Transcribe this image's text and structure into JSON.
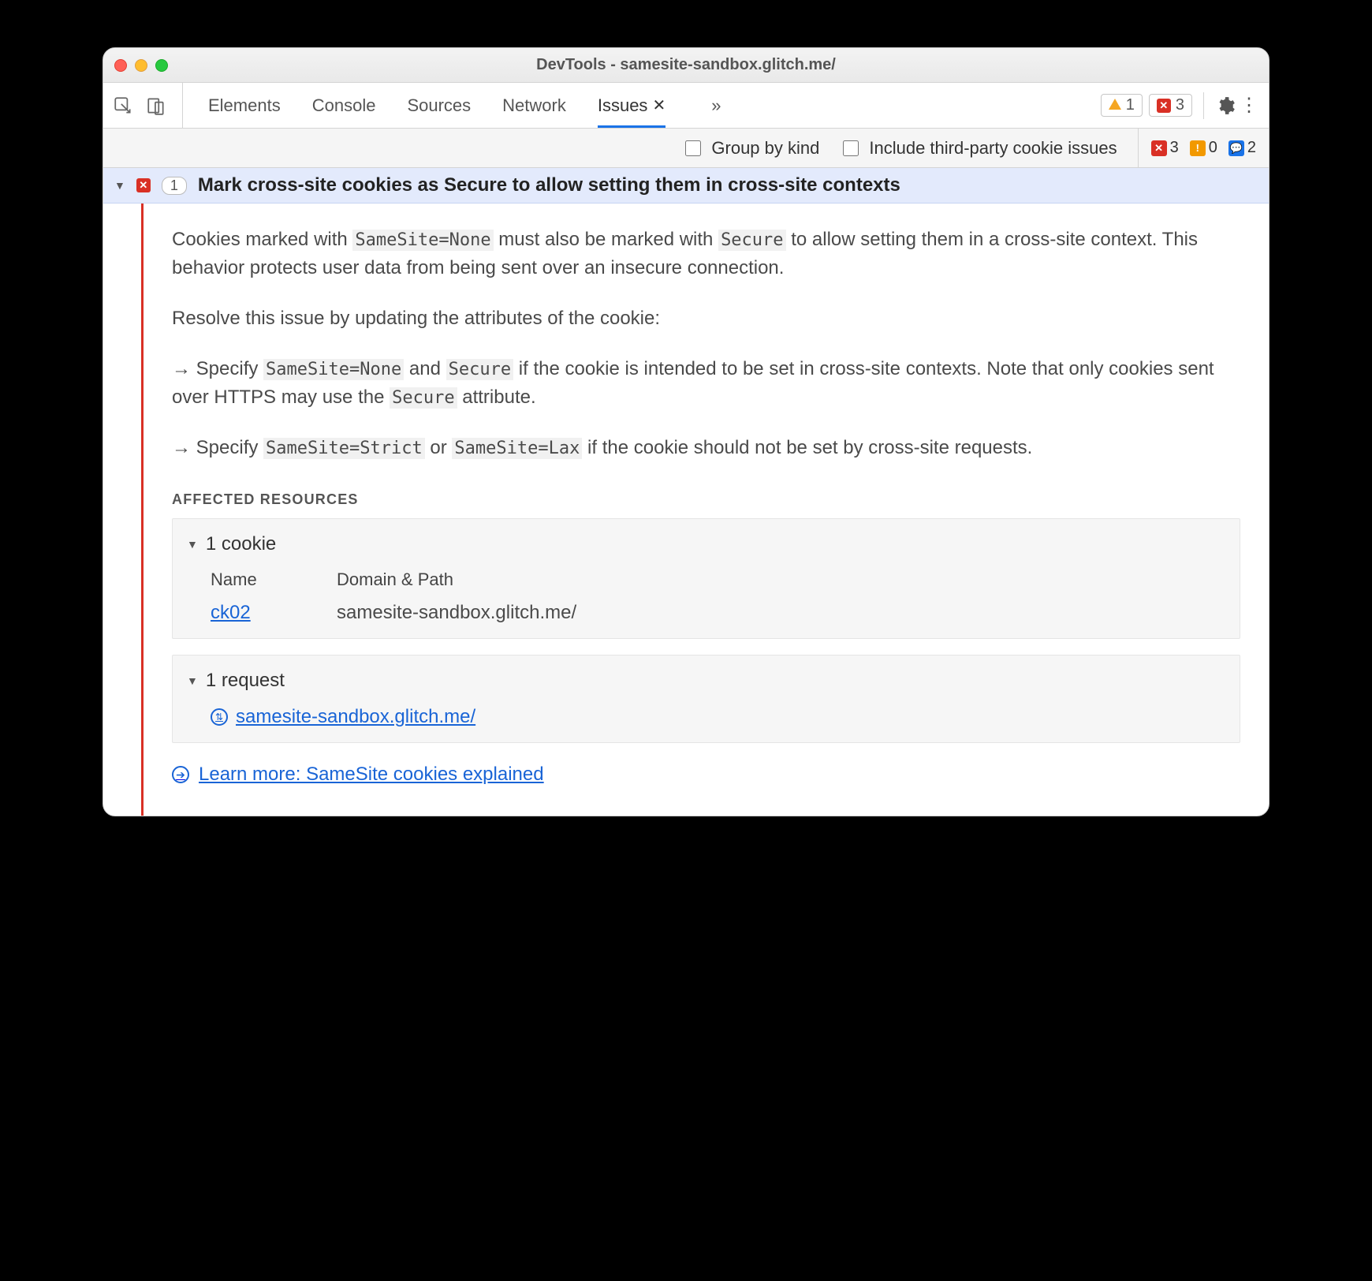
{
  "window_title": "DevTools - samesite-sandbox.glitch.me/",
  "tabs": {
    "items": [
      "Elements",
      "Console",
      "Sources",
      "Network"
    ],
    "active": "Issues",
    "overflow_glyph": "»"
  },
  "top_status": {
    "warnings": "1",
    "errors": "3"
  },
  "filter": {
    "group_by_kind": "Group by kind",
    "include_third_party": "Include third-party cookie issues",
    "counts": {
      "err": "3",
      "warn": "0",
      "info": "2"
    }
  },
  "issue": {
    "count": "1",
    "title": "Mark cross-site cookies as Secure to allow setting them in cross-site contexts",
    "p1a": "Cookies marked with ",
    "p1_code1": "SameSite=None",
    "p1b": " must also be marked with ",
    "p1_code2": "Secure",
    "p1c": " to allow setting them in a cross-site context. This behavior protects user data from being sent over an insecure connection.",
    "p2": "Resolve this issue by updating the attributes of the cookie:",
    "b1a": "Specify ",
    "b1_code1": "SameSite=None",
    "b1b": " and ",
    "b1_code2": "Secure",
    "b1c": " if the cookie is intended to be set in cross-site contexts. Note that only cookies sent over HTTPS may use the ",
    "b1_code3": "Secure",
    "b1d": " attribute.",
    "b2a": "Specify ",
    "b2_code1": "SameSite=Strict",
    "b2b": " or ",
    "b2_code2": "SameSite=Lax",
    "b2c": " if the cookie should not be set by cross-site requests.",
    "affected_label": "Affected Resources",
    "cookie_summary": "1 cookie",
    "col_name": "Name",
    "col_domain": "Domain & Path",
    "cookie_name": "ck02",
    "cookie_domain": "samesite-sandbox.glitch.me/",
    "request_summary": "1 request",
    "request_url": "samesite-sandbox.glitch.me/",
    "learn_more": "Learn more: SameSite cookies explained"
  }
}
